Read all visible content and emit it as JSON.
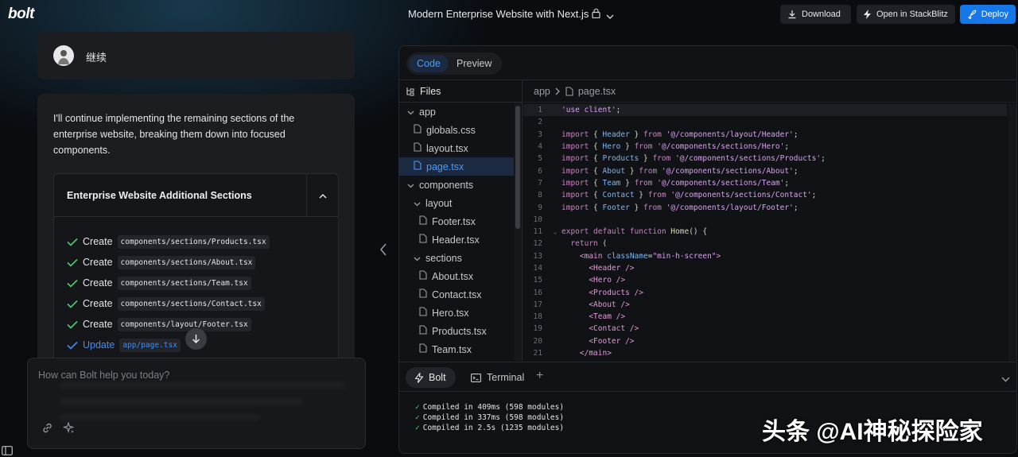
{
  "app": {
    "logo": "bolt",
    "project_title": "Modern Enterprise Website with Next.js"
  },
  "header": {
    "download_label": "Download",
    "stackblitz_label": "Open in StackBlitz",
    "deploy_label": "Deploy"
  },
  "chat": {
    "user_message": "继续",
    "assistant_message": "I'll continue implementing the remaining sections of the enterprise website, breaking them down into focused components.",
    "artifact": {
      "title": "Enterprise Website Additional Sections",
      "steps": [
        {
          "action": "Create",
          "path": "components/sections/Products.tsx"
        },
        {
          "action": "Create",
          "path": "components/sections/About.tsx"
        },
        {
          "action": "Create",
          "path": "components/sections/Team.tsx"
        },
        {
          "action": "Create",
          "path": "components/sections/Contact.tsx"
        },
        {
          "action": "Create",
          "path": "components/layout/Footer.tsx"
        },
        {
          "action": "Update",
          "path": "app/page.tsx"
        }
      ]
    },
    "prompt_placeholder": "How can Bolt help you today?"
  },
  "workbench": {
    "tabs": {
      "code": "Code",
      "preview": "Preview"
    },
    "files_label": "Files",
    "tree": [
      {
        "name": "app",
        "type": "folder",
        "depth": 0
      },
      {
        "name": "globals.css",
        "type": "file",
        "depth": 1
      },
      {
        "name": "layout.tsx",
        "type": "file",
        "depth": 1
      },
      {
        "name": "page.tsx",
        "type": "file",
        "depth": 1,
        "selected": true
      },
      {
        "name": "components",
        "type": "folder",
        "depth": 0
      },
      {
        "name": "layout",
        "type": "folder",
        "depth": 1
      },
      {
        "name": "Footer.tsx",
        "type": "file",
        "depth": 2
      },
      {
        "name": "Header.tsx",
        "type": "file",
        "depth": 2
      },
      {
        "name": "sections",
        "type": "folder",
        "depth": 1
      },
      {
        "name": "About.tsx",
        "type": "file",
        "depth": 2
      },
      {
        "name": "Contact.tsx",
        "type": "file",
        "depth": 2
      },
      {
        "name": "Hero.tsx",
        "type": "file",
        "depth": 2
      },
      {
        "name": "Products.tsx",
        "type": "file",
        "depth": 2
      },
      {
        "name": "Team.tsx",
        "type": "file",
        "depth": 2
      }
    ],
    "breadcrumb": {
      "folder": "app",
      "file": "page.tsx"
    },
    "code": {
      "import_names": [
        "Header",
        "Hero",
        "Products",
        "About",
        "Team",
        "Contact",
        "Footer"
      ],
      "import_paths": [
        "'@/components/layout/Header'",
        "'@/components/sections/Hero'",
        "'@/components/sections/Products'",
        "'@/components/sections/About'",
        "'@/components/sections/Team'",
        "'@/components/sections/Contact'",
        "'@/components/layout/Footer'"
      ],
      "directive": "'use client'",
      "main_class": "\"min-h-screen\"",
      "function_name": "Home"
    },
    "terminal": {
      "bolt_tab": "Bolt",
      "terminal_tab": "Terminal",
      "lines": [
        "Compiled in 409ms (598 modules)",
        "Compiled in 337ms (598 modules)",
        "Compiled in 2.5s (1235 modules)"
      ]
    }
  },
  "watermark": "头条 @AI神秘探险家",
  "colors": {
    "accent": "#1577e8",
    "link": "#3d8ff5",
    "check": "#4ecb71"
  }
}
